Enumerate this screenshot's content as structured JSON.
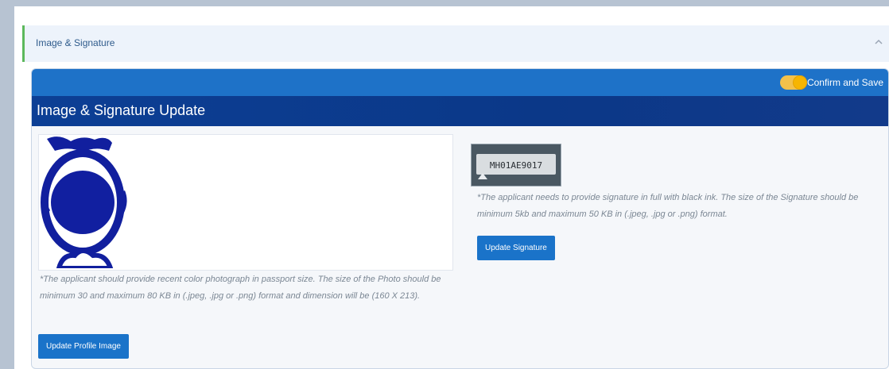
{
  "accordion": {
    "title": "Image & Signature"
  },
  "card": {
    "title": "Image & Signature Update",
    "toggle_label": "Confirm and Save",
    "toggle_on": true
  },
  "photo": {
    "help_text": "*The applicant should provide recent color photograph in passport size. The size of the Photo should be minimum 30 and maximum 80 KB in (.jpeg, .jpg or .png) format and dimension will be (160 X 213).",
    "button_label": "Update Profile Image"
  },
  "signature": {
    "image_text": "MH01AE9017",
    "help_text": "*The applicant needs to provide signature in full with black ink. The size of the Signature should be minimum 5kb and maximum 50 KB in (.jpeg, .jpg or .png) format.",
    "button_label": "Update Signature"
  },
  "colors": {
    "accent_blue": "#1a73c9",
    "title_bar": "#0c3f95",
    "toggle": "#f7b500",
    "status_green": "#5cb85c"
  }
}
